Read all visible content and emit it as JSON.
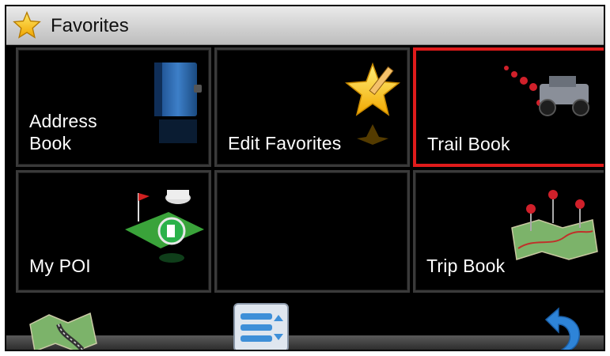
{
  "window": {
    "title": "Favorites",
    "title_icon": "star-icon"
  },
  "tiles": [
    {
      "label_line1": "Address",
      "label_line2": "Book",
      "icon": "address-book-icon"
    },
    {
      "label": "Edit Favorites",
      "icon": "star-pencil-icon"
    },
    {
      "label": "Trail Book",
      "icon": "jeep-trail-icon",
      "selected": true
    },
    {
      "label": "My POI",
      "icon": "poi-icon"
    },
    {
      "label": "",
      "icon": ""
    },
    {
      "label": "Trip Book",
      "icon": "map-pins-icon"
    }
  ],
  "bottom_bar": {
    "left_button_icon": "map-icon",
    "center_button_icon": "menu-list-icon",
    "right_button_icon": "back-arrow-icon"
  },
  "colors": {
    "selected_border": "#e01b1b",
    "tile_border": "#3a3a3a",
    "background": "#000000"
  }
}
